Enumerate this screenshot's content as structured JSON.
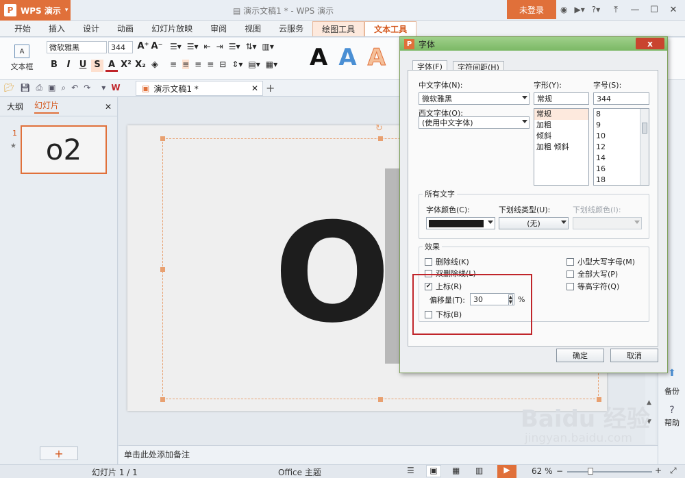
{
  "app": {
    "name": "WPS 演示",
    "logo_letter": "P",
    "window_title": "演示文稿1 * - WPS 演示",
    "login": "未登录",
    "accent": "#e0703a"
  },
  "menu_tabs": [
    "开始",
    "插入",
    "设计",
    "动画",
    "幻灯片放映",
    "审阅",
    "视图",
    "云服务",
    "绘图工具",
    "文本工具"
  ],
  "ribbon": {
    "textbox_label": "文本框",
    "font_name": "微软雅黑",
    "font_size": "344"
  },
  "document_tab": "演示文稿1 *",
  "left_panel": {
    "tab_outline": "大纲",
    "tab_slides": "幻灯片",
    "slide_number": "1",
    "thumb_text": "o2",
    "add_button": "+"
  },
  "slide": {
    "main_text": "O"
  },
  "notes_placeholder": "单击此处添加备注",
  "right_bar": {
    "backup": "备份",
    "help": "帮助",
    "backup_icon": "backup-icon",
    "help_icon": "help-icon"
  },
  "status": {
    "slide_indicator": "幻灯片 1 / 1",
    "theme": "Office 主题",
    "zoom": "62 %"
  },
  "dialog": {
    "title": "字体",
    "close": "x",
    "tabs": [
      "字体(F)",
      "字符间距(H)"
    ],
    "cn_font_label": "中文字体(N):",
    "cn_font_value": "微软雅黑",
    "western_font_label": "西文字体(O):",
    "western_font_value": "(使用中文字体)",
    "style_label": "字形(Y):",
    "style_value": "常规",
    "style_options": [
      "常规",
      "加粗",
      "倾斜",
      "加粗 倾斜"
    ],
    "size_label": "字号(S):",
    "size_value": "344",
    "size_options": [
      "8",
      "9",
      "10",
      "12",
      "14",
      "16",
      "18"
    ],
    "all_text_group": "所有文字",
    "font_color_label": "字体颜色(C):",
    "underline_type_label": "下划线类型(U):",
    "underline_type_value": "(无)",
    "underline_color_label": "下划线颜色(I):",
    "effects_group": "效果",
    "strike": "删除线(K)",
    "double_strike": "双删除线(L)",
    "superscript": "上标(R)",
    "offset_label": "偏移量(T):",
    "offset_value": "30",
    "percent": "%",
    "subscript": "下标(B)",
    "small_caps": "小型大写字母(M)",
    "all_caps": "全部大写(P)",
    "equal_height": "等高字符(Q)",
    "ok": "确定",
    "cancel": "取消"
  },
  "watermark": {
    "brand": "Baidu",
    "brand_cn": "经验",
    "url": "jingyan.baidu.com"
  }
}
